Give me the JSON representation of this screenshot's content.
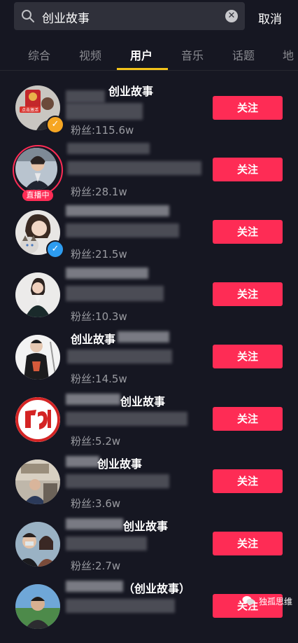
{
  "search": {
    "query": "创业故事",
    "cancel_label": "取消"
  },
  "tabs": [
    "综合",
    "视频",
    "用户",
    "音乐",
    "话题",
    "地"
  ],
  "active_tab": "用户",
  "users": [
    {
      "name_suffix": "创业故事",
      "fans": "粉丝:115.6w",
      "follow_label": "关注",
      "badge": "gold-verified",
      "avatar_tag": "点击激活"
    },
    {
      "name_suffix": "",
      "fans": "粉丝:28.1w",
      "follow_label": "关注",
      "badge": "live",
      "live_label": "直播中"
    },
    {
      "name_suffix": "",
      "fans": "粉丝:21.5w",
      "follow_label": "关注",
      "badge": "blue-verified"
    },
    {
      "name_suffix": "",
      "fans": "粉丝:10.3w",
      "follow_label": "关注",
      "badge": "none"
    },
    {
      "name_prefix": "创业故事",
      "fans": "粉丝:14.5w",
      "follow_label": "关注",
      "badge": "none"
    },
    {
      "name_suffix": "创业故事",
      "fans": "粉丝:5.2w",
      "follow_label": "关注",
      "badge": "none"
    },
    {
      "name_suffix": "创业故事",
      "fans": "粉丝:3.6w",
      "follow_label": "关注",
      "badge": "none"
    },
    {
      "name_suffix": "创业故事",
      "fans": "粉丝:2.7w",
      "follow_label": "关注",
      "badge": "none"
    },
    {
      "name_suffix": "（创业故事）",
      "fans": "",
      "follow_label": "关注",
      "badge": "none"
    }
  ],
  "watermark": "独孤思维",
  "colors": {
    "background": "#161722",
    "accent": "#fe2c55",
    "tab_indicator": "#f3c31a",
    "verified_gold": "#f6a623",
    "verified_blue": "#2d9cf0"
  }
}
